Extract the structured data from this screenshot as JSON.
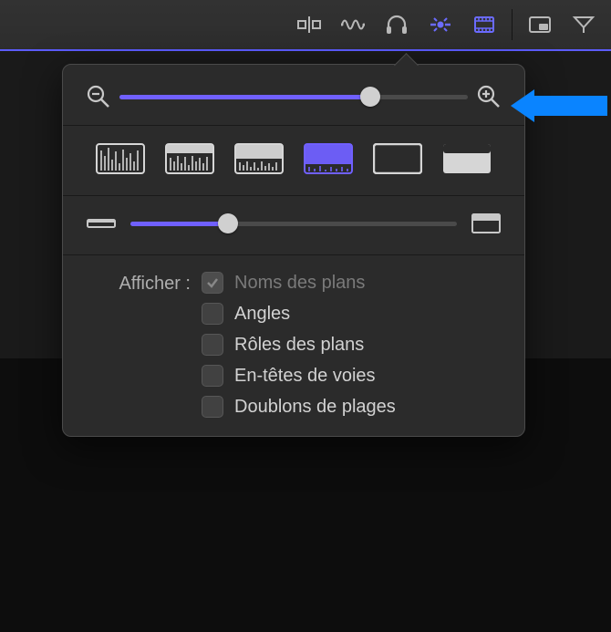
{
  "colors": {
    "accent": "#7060ff",
    "arrow": "#0a84ff",
    "panel": "#2b2b2b",
    "toolbar": "#303030"
  },
  "toolbar": {
    "items": [
      {
        "name": "trim-tool-icon",
        "active": false
      },
      {
        "name": "audio-waveform-icon",
        "active": false
      },
      {
        "name": "headphones-icon",
        "active": false
      },
      {
        "name": "snapping-icon",
        "active": true
      },
      {
        "name": "clip-appearance-icon",
        "active": true
      },
      {
        "name": "pip-icon",
        "active": false
      },
      {
        "name": "share-icon",
        "active": false
      }
    ]
  },
  "popover": {
    "zoom": {
      "value_pct": 72
    },
    "clip_views": {
      "selected_index": 3,
      "names": [
        "waveform-only",
        "waveform-large",
        "waveform-medium",
        "filmstrip-waveform",
        "filmstrip-only",
        "solid"
      ]
    },
    "clip_height": {
      "value_pct": 30
    },
    "show": {
      "label": "Afficher :",
      "options": [
        {
          "key": "clip_names",
          "label": "Noms des plans",
          "checked": true,
          "dim": true
        },
        {
          "key": "angles",
          "label": "Angles",
          "checked": false
        },
        {
          "key": "clip_roles",
          "label": "Rôles des plans",
          "checked": false
        },
        {
          "key": "lane_headers",
          "label": "En-têtes de voies",
          "checked": false
        },
        {
          "key": "dup_ranges",
          "label": "Doublons de plages",
          "checked": false
        }
      ]
    }
  },
  "callout": {
    "points_to": "zoom-in-icon"
  }
}
